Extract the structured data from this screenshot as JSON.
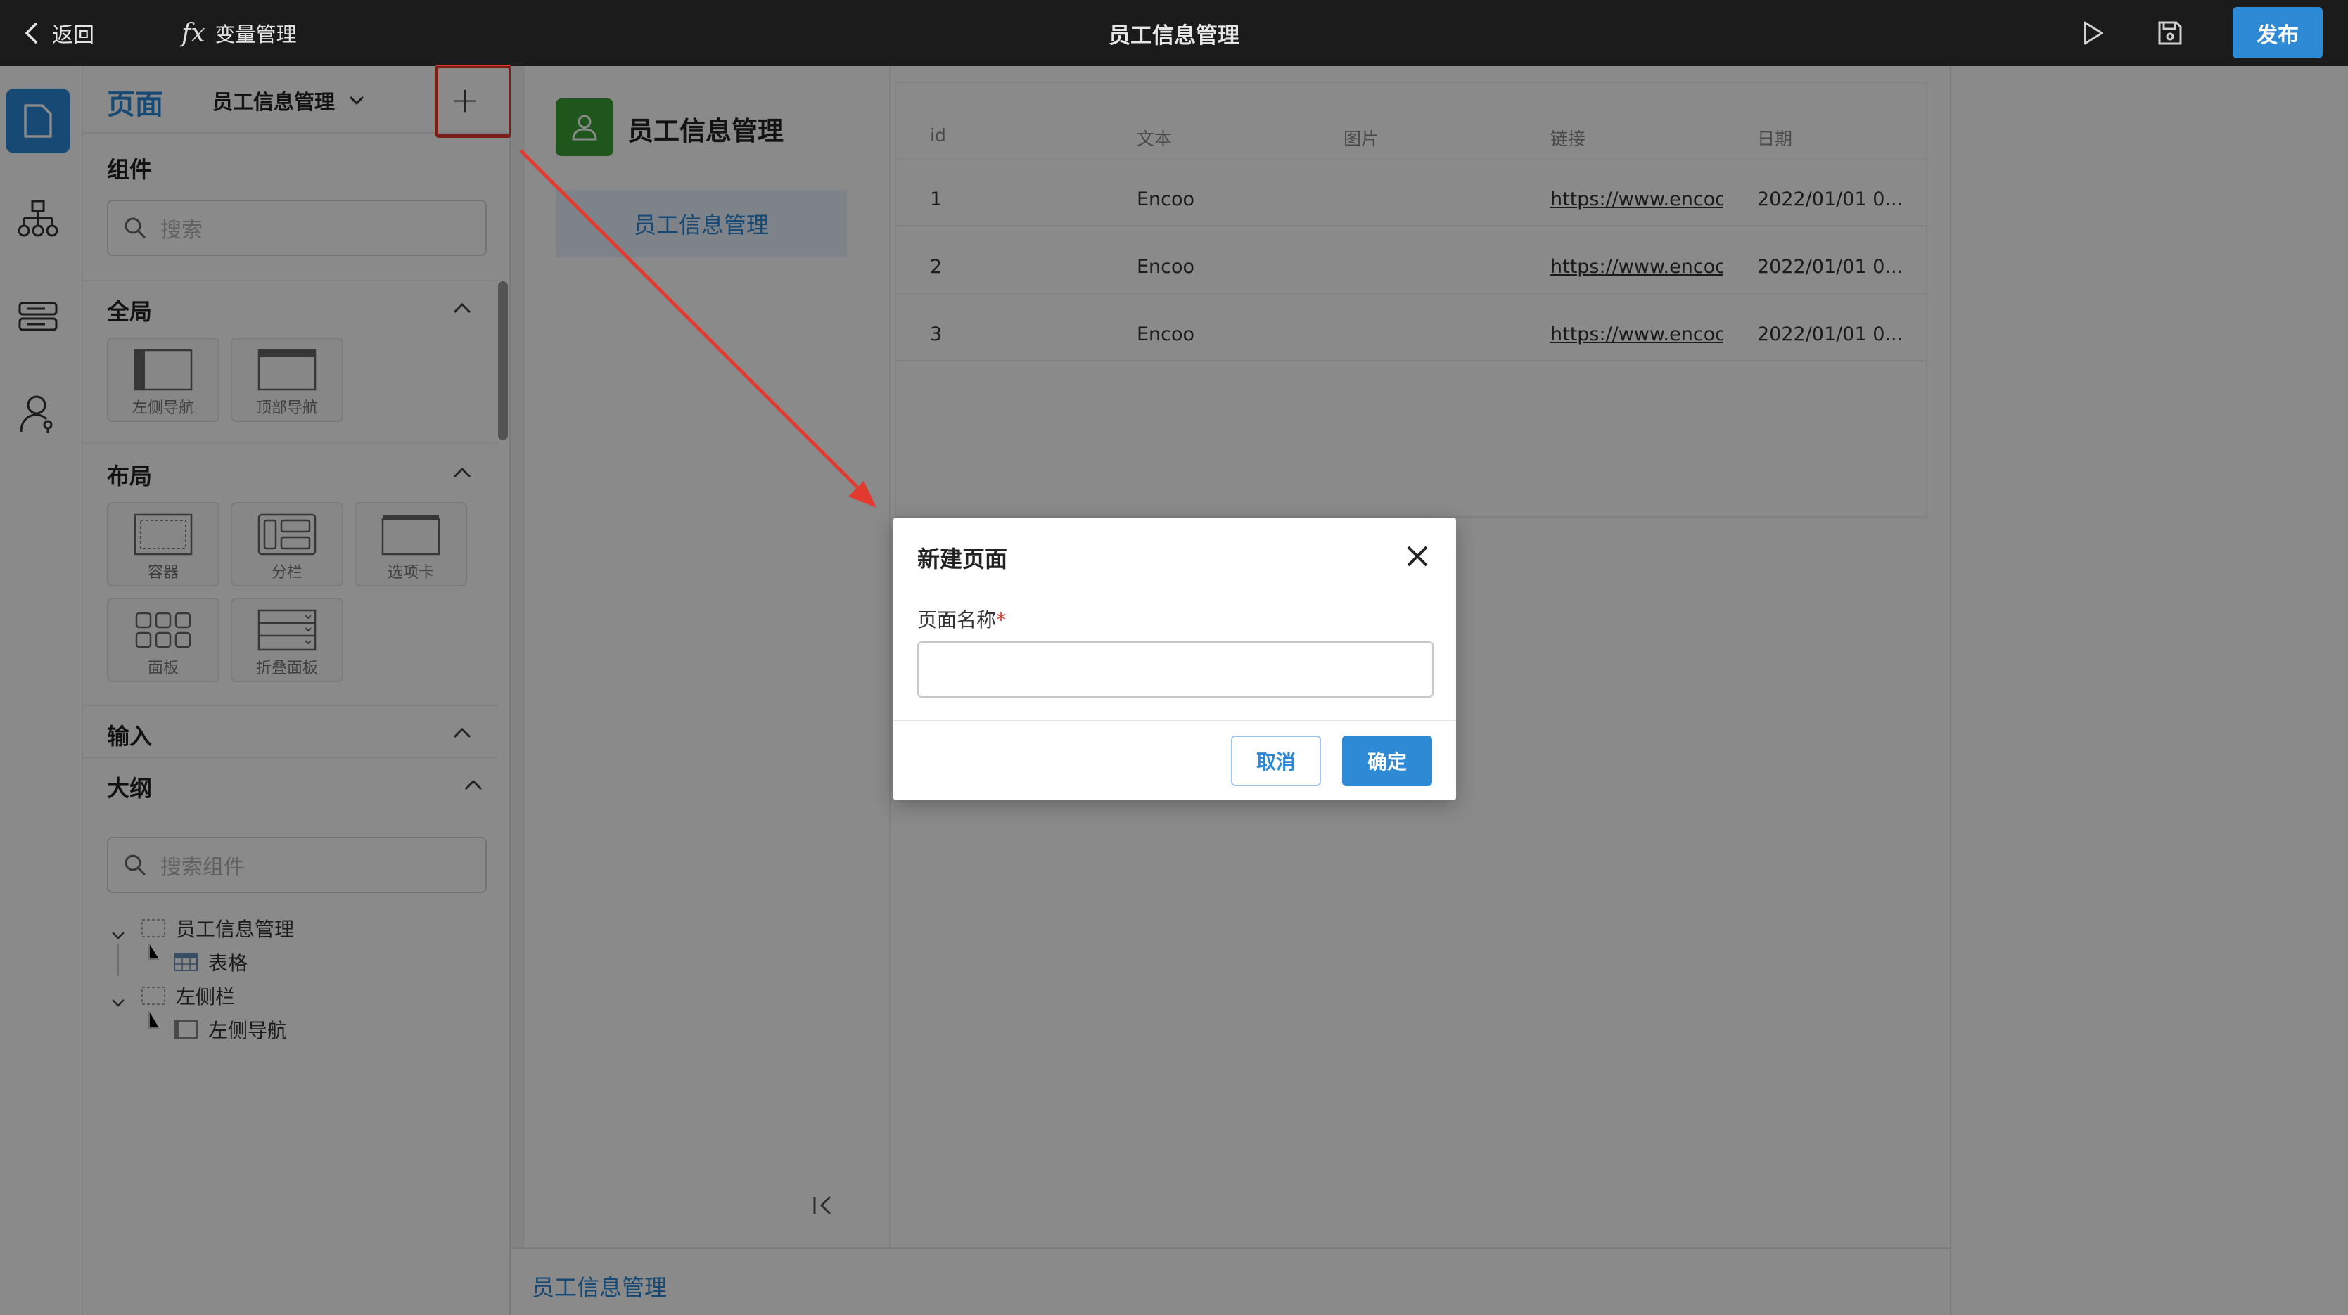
{
  "topbar": {
    "back_label": "返回",
    "fx_label": "fx",
    "variables_label": "变量管理",
    "title": "员工信息管理",
    "publish_label": "发布"
  },
  "panel": {
    "tab_label": "页面",
    "page_selector": "员工信息管理",
    "add_symbol": "+",
    "components_title": "组件",
    "search_placeholder": "搜索",
    "groups": {
      "global": {
        "title": "全局",
        "items": [
          "左侧导航",
          "顶部导航"
        ]
      },
      "layout": {
        "title": "布局",
        "items": [
          "容器",
          "分栏",
          "选项卡",
          "面板",
          "折叠面板"
        ],
        "tab_glyph": "Tab"
      },
      "input": {
        "title": "输入"
      }
    },
    "outline_title": "大纲",
    "outline_search_placeholder": "搜索组件",
    "tree": [
      "员工信息管理",
      "表格",
      "左侧栏",
      "左侧导航"
    ]
  },
  "preview": {
    "app_title": "员工信息管理",
    "nav_item": "员工信息管理",
    "table": {
      "headers": [
        "id",
        "文本",
        "图片",
        "链接",
        "日期"
      ],
      "rows": [
        [
          "1",
          "Encoo",
          "",
          "https://www.encoo.com",
          "2022/01/01 0..."
        ],
        [
          "2",
          "Encoo",
          "",
          "https://www.encoo.com",
          "2022/01/01 0..."
        ],
        [
          "3",
          "Encoo",
          "",
          "https://www.encoo.com",
          "2022/01/01 0..."
        ]
      ]
    }
  },
  "footer": {
    "page_name": "员工信息管理"
  },
  "dialog": {
    "title": "新建页面",
    "field_label": "页面名称",
    "required_mark": "*",
    "input_value": "",
    "cancel_label": "取消",
    "ok_label": "确定"
  },
  "colors": {
    "accent": "#2b88d8",
    "highlight_red": "#e23a2e",
    "logo_green": "#3aa035",
    "topbar_bg": "#1b1b1c"
  }
}
